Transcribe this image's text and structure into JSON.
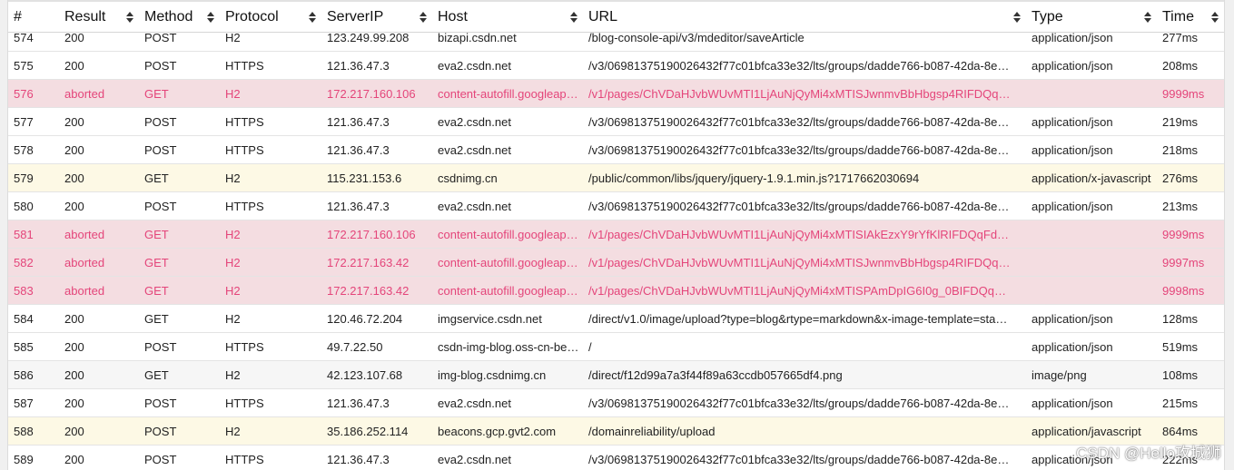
{
  "columns": [
    {
      "key": "num",
      "label": "#",
      "sortable": false
    },
    {
      "key": "result",
      "label": "Result",
      "sortable": true
    },
    {
      "key": "method",
      "label": "Method",
      "sortable": true
    },
    {
      "key": "protocol",
      "label": "Protocol",
      "sortable": true
    },
    {
      "key": "ip",
      "label": "ServerIP",
      "sortable": true
    },
    {
      "key": "host",
      "label": "Host",
      "sortable": true
    },
    {
      "key": "url",
      "label": "URL",
      "sortable": true
    },
    {
      "key": "type",
      "label": "Type",
      "sortable": true
    },
    {
      "key": "time",
      "label": "Time",
      "sortable": true
    }
  ],
  "row_state_colors": {
    "aborted_bg": "#f4dde1",
    "aborted_text": "#e4457a",
    "script_bg": "#fdf9e5"
  },
  "rows": [
    {
      "num": "574",
      "result": "200",
      "method": "POST",
      "protocol": "H2",
      "ip": "123.249.99.208",
      "host": "bizapi.csdn.net",
      "url": "/blog-console-api/v3/mdeditor/saveArticle",
      "type": "application/json",
      "time": "277ms",
      "state": "normal"
    },
    {
      "num": "575",
      "result": "200",
      "method": "POST",
      "protocol": "HTTPS",
      "ip": "121.36.47.3",
      "host": "eva2.csdn.net",
      "url": "/v3/06981375190026432f77c01bfca33e32/lts/groups/dadde766-b087-42da-8e…",
      "type": "application/json",
      "time": "208ms",
      "state": "normal"
    },
    {
      "num": "576",
      "result": "aborted",
      "method": "GET",
      "protocol": "H2",
      "ip": "172.217.160.106",
      "host": "content-autofill.googleap…",
      "url": "/v1/pages/ChVDaHJvbWUvMTI1LjAuNjQyMi4xMTISJwnmvBbHbgsp4RIFDQq…",
      "type": "",
      "time": "9999ms",
      "state": "aborted"
    },
    {
      "num": "577",
      "result": "200",
      "method": "POST",
      "protocol": "HTTPS",
      "ip": "121.36.47.3",
      "host": "eva2.csdn.net",
      "url": "/v3/06981375190026432f77c01bfca33e32/lts/groups/dadde766-b087-42da-8e…",
      "type": "application/json",
      "time": "219ms",
      "state": "normal"
    },
    {
      "num": "578",
      "result": "200",
      "method": "POST",
      "protocol": "HTTPS",
      "ip": "121.36.47.3",
      "host": "eva2.csdn.net",
      "url": "/v3/06981375190026432f77c01bfca33e32/lts/groups/dadde766-b087-42da-8e…",
      "type": "application/json",
      "time": "218ms",
      "state": "normal"
    },
    {
      "num": "579",
      "result": "200",
      "method": "GET",
      "protocol": "H2",
      "ip": "115.231.153.6",
      "host": "csdnimg.cn",
      "url": "/public/common/libs/jquery/jquery-1.9.1.min.js?1717662030694",
      "type": "application/x-javascript",
      "time": "276ms",
      "state": "script"
    },
    {
      "num": "580",
      "result": "200",
      "method": "POST",
      "protocol": "HTTPS",
      "ip": "121.36.47.3",
      "host": "eva2.csdn.net",
      "url": "/v3/06981375190026432f77c01bfca33e32/lts/groups/dadde766-b087-42da-8e…",
      "type": "application/json",
      "time": "213ms",
      "state": "normal"
    },
    {
      "num": "581",
      "result": "aborted",
      "method": "GET",
      "protocol": "H2",
      "ip": "172.217.160.106",
      "host": "content-autofill.googleap…",
      "url": "/v1/pages/ChVDaHJvbWUvMTI1LjAuNjQyMi4xMTISIAkEzxY9rYfKlRIFDQqFd…",
      "type": "",
      "time": "9999ms",
      "state": "aborted"
    },
    {
      "num": "582",
      "result": "aborted",
      "method": "GET",
      "protocol": "H2",
      "ip": "172.217.163.42",
      "host": "content-autofill.googleap…",
      "url": "/v1/pages/ChVDaHJvbWUvMTI1LjAuNjQyMi4xMTISJwnmvBbHbgsp4RIFDQq…",
      "type": "",
      "time": "9997ms",
      "state": "aborted"
    },
    {
      "num": "583",
      "result": "aborted",
      "method": "GET",
      "protocol": "H2",
      "ip": "172.217.163.42",
      "host": "content-autofill.googleap…",
      "url": "/v1/pages/ChVDaHJvbWUvMTI1LjAuNjQyMi4xMTISPAmDpIG6I0g_0BIFDQq…",
      "type": "",
      "time": "9998ms",
      "state": "aborted"
    },
    {
      "num": "584",
      "result": "200",
      "method": "GET",
      "protocol": "H2",
      "ip": "120.46.72.204",
      "host": "imgservice.csdn.net",
      "url": "/direct/v1.0/image/upload?type=blog&rtype=markdown&x-image-template=sta…",
      "type": "application/json",
      "time": "128ms",
      "state": "normal"
    },
    {
      "num": "585",
      "result": "200",
      "method": "POST",
      "protocol": "HTTPS",
      "ip": "49.7.22.50",
      "host": "csdn-img-blog.oss-cn-be…",
      "url": "/",
      "type": "application/json",
      "time": "519ms",
      "state": "normal"
    },
    {
      "num": "586",
      "result": "200",
      "method": "GET",
      "protocol": "H2",
      "ip": "42.123.107.68",
      "host": "img-blog.csdnimg.cn",
      "url": "/direct/f12d99a7a3f44f89a63ccdb057665df4.png",
      "type": "image/png",
      "time": "108ms",
      "state": "alt"
    },
    {
      "num": "587",
      "result": "200",
      "method": "POST",
      "protocol": "HTTPS",
      "ip": "121.36.47.3",
      "host": "eva2.csdn.net",
      "url": "/v3/06981375190026432f77c01bfca33e32/lts/groups/dadde766-b087-42da-8e…",
      "type": "application/json",
      "time": "215ms",
      "state": "normal"
    },
    {
      "num": "588",
      "result": "200",
      "method": "POST",
      "protocol": "H2",
      "ip": "35.186.252.114",
      "host": "beacons.gcp.gvt2.com",
      "url": "/domainreliability/upload",
      "type": "application/javascript",
      "time": "864ms",
      "state": "script"
    },
    {
      "num": "589",
      "result": "200",
      "method": "POST",
      "protocol": "HTTPS",
      "ip": "121.36.47.3",
      "host": "eva2.csdn.net",
      "url": "/v3/06981375190026432f77c01bfca33e32/lts/groups/dadde766-b087-42da-8e…",
      "type": "application/json",
      "time": "222ms",
      "state": "normal"
    }
  ],
  "watermark": "CSDN @Hello攻城狮"
}
